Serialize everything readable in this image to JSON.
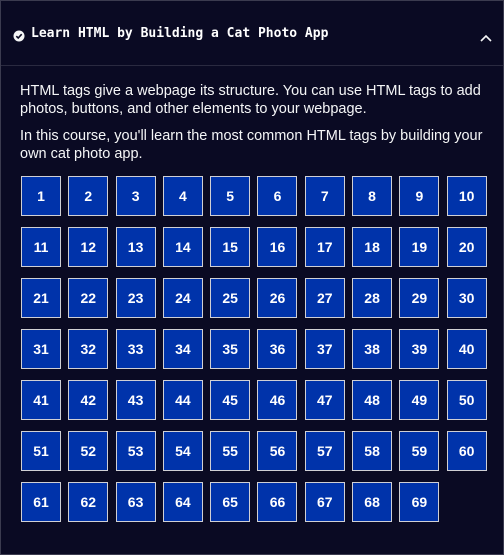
{
  "block": {
    "title": "Learn HTML by Building a Cat Photo App",
    "completed_icon": "check-circle-icon",
    "toggle_icon": "chevron-up-icon"
  },
  "intro": [
    "HTML tags give a webpage its structure. You can use HTML tags to add photos, buttons, and other elements to your webpage.",
    "In this course, you'll learn the most common HTML tags by building your own cat photo app."
  ],
  "steps": [
    "1",
    "2",
    "3",
    "4",
    "5",
    "6",
    "7",
    "8",
    "9",
    "10",
    "11",
    "12",
    "13",
    "14",
    "15",
    "16",
    "17",
    "18",
    "19",
    "20",
    "21",
    "22",
    "23",
    "24",
    "25",
    "26",
    "27",
    "28",
    "29",
    "30",
    "31",
    "32",
    "33",
    "34",
    "35",
    "36",
    "37",
    "38",
    "39",
    "40",
    "41",
    "42",
    "43",
    "44",
    "45",
    "46",
    "47",
    "48",
    "49",
    "50",
    "51",
    "52",
    "53",
    "54",
    "55",
    "56",
    "57",
    "58",
    "59",
    "60",
    "61",
    "62",
    "63",
    "64",
    "65",
    "66",
    "67",
    "68",
    "69"
  ],
  "colors": {
    "background": "#0a0a23",
    "step_fill": "#0033aa",
    "step_border": "#d0d0d5"
  }
}
